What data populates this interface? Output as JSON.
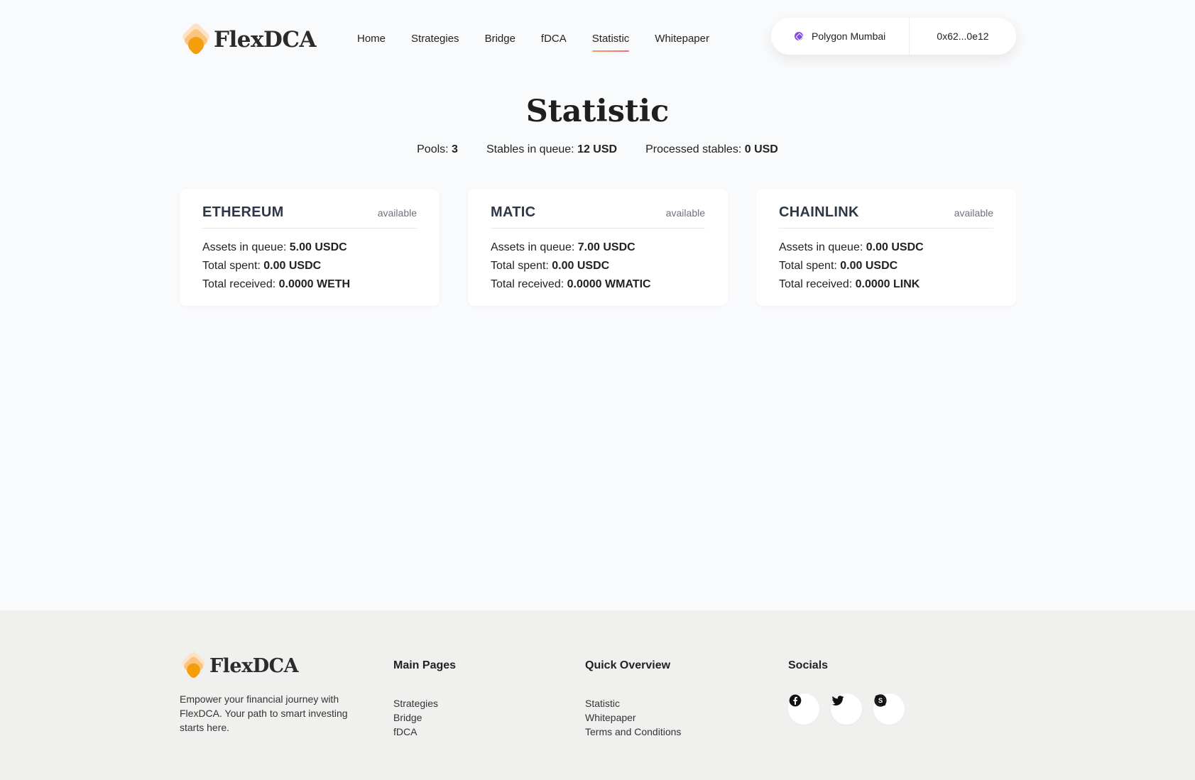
{
  "brand": {
    "name": "FlexDCA"
  },
  "nav": {
    "items": [
      {
        "label": "Home"
      },
      {
        "label": "Strategies"
      },
      {
        "label": "Bridge"
      },
      {
        "label": "fDCA"
      },
      {
        "label": "Statistic"
      },
      {
        "label": "Whitepaper"
      }
    ],
    "active": "Statistic"
  },
  "wallet": {
    "network": "Polygon Mumbai",
    "address": "0x62...0e12"
  },
  "page": {
    "title": "Statistic",
    "summary": {
      "pools_label": "Pools:",
      "pools_value": "3",
      "queue_label": "Stables in queue:",
      "queue_value": "12 USD",
      "processed_label": "Processed stables:",
      "processed_value": "0 USD"
    }
  },
  "pools": [
    {
      "name": "ETHEREUM",
      "status": "available",
      "queue_label": "Assets in queue:",
      "queue": "5.00 USDC",
      "spent_label": "Total spent:",
      "spent": "0.00 USDC",
      "received_label": "Total received:",
      "received": "0.0000 WETH"
    },
    {
      "name": "MATIC",
      "status": "available",
      "queue_label": "Assets in queue:",
      "queue": "7.00 USDC",
      "spent_label": "Total spent:",
      "spent": "0.00 USDC",
      "received_label": "Total received:",
      "received": "0.0000 WMATIC"
    },
    {
      "name": "CHAINLINK",
      "status": "available",
      "queue_label": "Assets in queue:",
      "queue": "0.00 USDC",
      "spent_label": "Total spent:",
      "spent": "0.00 USDC",
      "received_label": "Total received:",
      "received": "0.0000 LINK"
    }
  ],
  "footer": {
    "description": "Empower your financial journey with FlexDCA. Your path to smart investing starts here.",
    "main_pages": {
      "title": "Main Pages",
      "links": [
        "Strategies",
        "Bridge",
        "fDCA"
      ]
    },
    "quick_overview": {
      "title": "Quick Overview",
      "links": [
        "Statistic",
        "Whitepaper",
        "Terms and Conditions"
      ]
    },
    "socials": {
      "title": "Socials",
      "icons": [
        "facebook-icon",
        "twitter-icon",
        "skype-icon"
      ]
    }
  },
  "colors": {
    "accent_start": "#f7a15c",
    "accent_end": "#f26d7d",
    "logo_orange": "#f59e0b",
    "polygon_purple": "#8247e5",
    "footer_bg": "#f0f1ef",
    "page_bg": "#f9fafb"
  }
}
